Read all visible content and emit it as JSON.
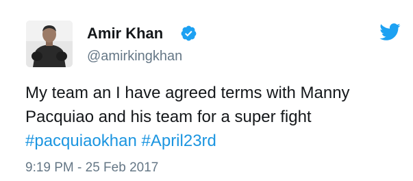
{
  "author": {
    "display_name": "Amir Khan",
    "handle": "@amirkingkhan",
    "verified": true
  },
  "icons": {
    "verified": "verified-badge-icon",
    "brand": "twitter-bird-icon",
    "avatar": "profile-photo"
  },
  "tweet": {
    "line1": "My team an I have agreed terms with Manny",
    "line2": "Pacquiao and his team for a super fight",
    "hashtags": [
      "#pacquiaokhan",
      "#April23rd"
    ],
    "timestamp": "9:19 PM - 25 Feb 2017"
  },
  "colors": {
    "brand_blue": "#1da1f2",
    "hashtag": "#1b95e0",
    "secondary_text": "#657786",
    "primary_text": "#14171a"
  }
}
